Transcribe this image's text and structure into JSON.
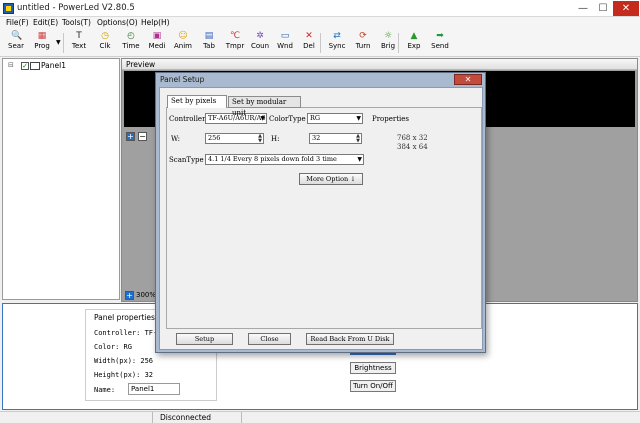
{
  "window": {
    "title": "untitled - PowerLed V2.80.5",
    "min": "—",
    "max": "☐",
    "close": "✕"
  },
  "menu": [
    "File(F)",
    "Edit(E)",
    "Tools(T)",
    "Options(O)",
    "Help(H)"
  ],
  "toolbar": [
    {
      "label": "Sear",
      "icon": "search-icon",
      "glyph": "🔍",
      "color": "#2f6fcf"
    },
    {
      "label": "Prog",
      "icon": "program-icon",
      "glyph": "▦",
      "color": "#d04040"
    },
    {
      "label": "Text",
      "icon": "text-icon",
      "glyph": "T",
      "color": "#2a2a2a"
    },
    {
      "label": "Clk",
      "icon": "clock-icon",
      "glyph": "◷",
      "color": "#d8a000"
    },
    {
      "label": "Time",
      "icon": "time-icon",
      "glyph": "◴",
      "color": "#3a7a3a"
    },
    {
      "label": "Medi",
      "icon": "media-icon",
      "glyph": "▣",
      "color": "#b03090"
    },
    {
      "label": "Anim",
      "icon": "animation-icon",
      "glyph": "☺",
      "color": "#e0a000"
    },
    {
      "label": "Tab",
      "icon": "table-icon",
      "glyph": "▤",
      "color": "#3060c0"
    },
    {
      "label": "Tmpr",
      "icon": "temperature-icon",
      "glyph": "℃",
      "color": "#d03030"
    },
    {
      "label": "Coun",
      "icon": "counter-icon",
      "glyph": "✲",
      "color": "#7a40c0"
    },
    {
      "label": "Wnd",
      "icon": "window-icon",
      "glyph": "▭",
      "color": "#2060b0"
    },
    {
      "label": "Del",
      "icon": "delete-icon",
      "glyph": "✕",
      "color": "#d02020"
    },
    {
      "label": "Sync",
      "icon": "sync-icon",
      "glyph": "⇄",
      "color": "#2070c0"
    },
    {
      "label": "Turn",
      "icon": "turn-icon",
      "glyph": "⟳",
      "color": "#c04020"
    },
    {
      "label": "Brig",
      "icon": "brightness-icon",
      "glyph": "☼",
      "color": "#409030"
    },
    {
      "label": "Exp",
      "icon": "export-icon",
      "glyph": "▲",
      "color": "#2a9a2a"
    },
    {
      "label": "Send",
      "icon": "send-icon",
      "glyph": "➡",
      "color": "#1f9a3a"
    }
  ],
  "tree": {
    "expander": "⊟",
    "check": "✓",
    "item": "Panel1"
  },
  "preview": {
    "title": "Preview",
    "plus": "+",
    "minus": "−",
    "zoom": "300%"
  },
  "properties": {
    "title": "Panel properties",
    "controller": "Controller: TF-A6U",
    "color": "Color: RG",
    "width": "Width(px): 256",
    "height": "Height(px): 32",
    "name_label": "Name:",
    "name_value": "Panel1",
    "brightness_button": "Brightness",
    "turn_button": "Turn On/Off"
  },
  "status": {
    "text": "Disconnected"
  },
  "dialog": {
    "title": "Panel Setup",
    "close": "✕",
    "tabs": [
      "Set by pixels",
      "Set by modular unit"
    ],
    "controller_label": "Controller",
    "controller_value": "TF-A6U/A6UR/A6",
    "colortype_label": "ColorType",
    "colortype_value": "RG",
    "w_label": "W:",
    "w_value": "256",
    "h_label": "H:",
    "h_value": "32",
    "scantype_label": "ScanType",
    "scantype_value": "4.1  1/4 Every 8 pixels down fold 3 time",
    "properties_label": "Properties",
    "props_line1": "768 x 32",
    "props_line2": "384 x 64",
    "more_option": "More Option ↓",
    "setup_button": "Setup",
    "close_button": "Close",
    "readback_button": "Read Back From U Disk"
  }
}
